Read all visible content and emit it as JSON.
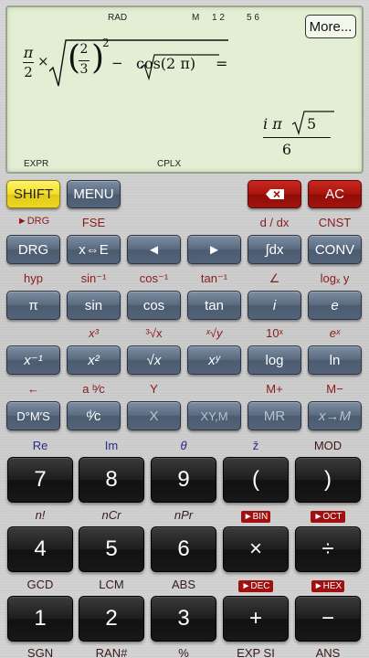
{
  "display": {
    "indicators": {
      "rad": "RAD",
      "m": "M",
      "m_nums1": "1 2",
      "m_nums2": "5 6",
      "expr": "EXPR",
      "cplx": "CPLX"
    },
    "more_label": "More...",
    "expression": {
      "pi": "π",
      "two": "2",
      "times": "×",
      "two_b": "2",
      "three": "3",
      "exp_two": "2",
      "minus": "−",
      "cos_text": "cos(2 π)",
      "equals": "="
    },
    "result": {
      "i_pi": "i π",
      "five": "5",
      "six": "6"
    }
  },
  "top_keys": {
    "shift": "SHIFT",
    "menu": "MENU",
    "backspace_icon": "backspace-icon",
    "ac": "AC"
  },
  "row1": {
    "labels": [
      "►DRG",
      "FSE",
      "d / dx",
      "CNST"
    ],
    "keys": [
      "DRG",
      "x⇔E",
      "◄",
      "►",
      "∫dx",
      "CONV"
    ]
  },
  "row2": {
    "labels": [
      "hyp",
      "sin⁻¹",
      "cos⁻¹",
      "tan⁻¹",
      "∠",
      "logₓ y"
    ],
    "keys": [
      "π",
      "sin",
      "cos",
      "tan",
      "i",
      "e"
    ]
  },
  "row3": {
    "labels": [
      "x³",
      "³√x",
      "ˣ√y",
      "10ˣ",
      "eˣ"
    ],
    "keys": [
      "x⁻¹",
      "x²",
      "√x",
      "xʸ",
      "log",
      "ln"
    ]
  },
  "row4": {
    "labels": [
      "←",
      "a ᵇ⁄c",
      "Y",
      "M+",
      "M−"
    ],
    "keys": [
      "D°M′S",
      "ᵈ⁄c",
      "X",
      "XY,M",
      "MR",
      "x→M"
    ]
  },
  "row5": {
    "labels": [
      "Re",
      "Im",
      "θ",
      "z̄",
      "MOD"
    ],
    "keys": [
      "7",
      "8",
      "9",
      "(",
      ")"
    ]
  },
  "row6": {
    "labels": [
      "n!",
      "nCr",
      "nPr",
      "►BIN",
      "►OCT"
    ],
    "keys": [
      "4",
      "5",
      "6",
      "×",
      "÷"
    ]
  },
  "row7": {
    "labels": [
      "GCD",
      "LCM",
      "ABS",
      "►DEC",
      "►HEX"
    ],
    "keys": [
      "1",
      "2",
      "3",
      "+",
      "−"
    ]
  },
  "row8": {
    "labels": [
      "SGN",
      "RAN#",
      "%",
      "EXP SI",
      "ANS"
    ]
  },
  "colors": {
    "display_bg": "#e3efd4",
    "key_blue": "#5a6b80",
    "key_red": "#a8140e",
    "key_yellow": "#f2de2a",
    "label_red": "#8b1a1a",
    "label_blue": "#2a2a8a"
  }
}
